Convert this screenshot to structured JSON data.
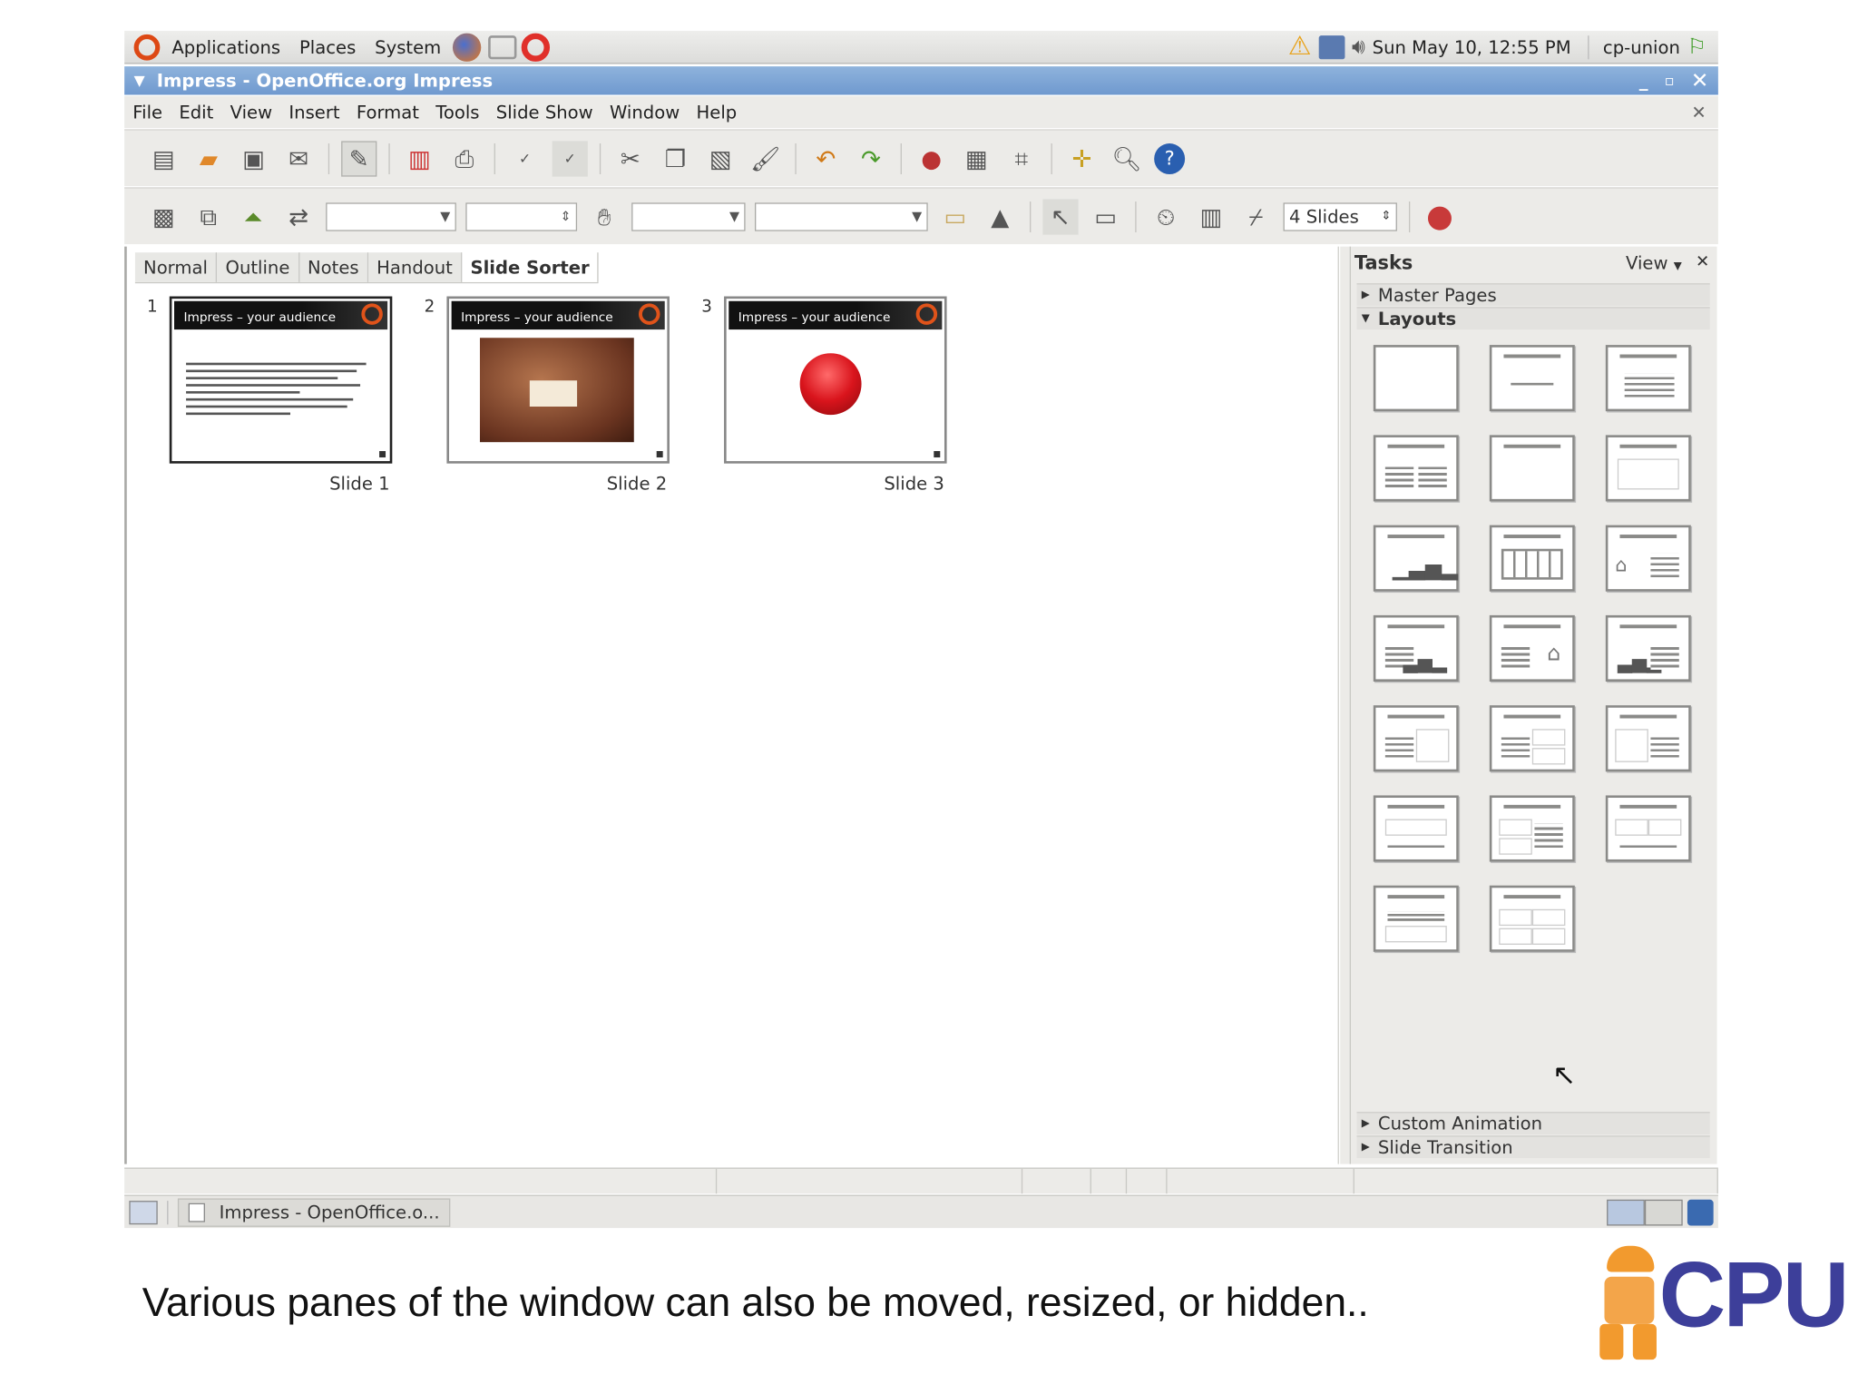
{
  "panel": {
    "applications": "Applications",
    "places": "Places",
    "system": "System",
    "clock": "Sun May 10, 12:55 PM",
    "user": "cp-union"
  },
  "window": {
    "title": "Impress - OpenOffice.org Impress"
  },
  "menus": [
    "File",
    "Edit",
    "View",
    "Insert",
    "Format",
    "Tools",
    "Slide Show",
    "Window",
    "Help"
  ],
  "slides_per_row": "4 Slides",
  "view_tabs": [
    "Normal",
    "Outline",
    "Notes",
    "Handout",
    "Slide Sorter"
  ],
  "slides": [
    {
      "number": "1",
      "label": "Slide 1",
      "header": "Impress – your audience"
    },
    {
      "number": "2",
      "label": "Slide 2",
      "header": "Impress – your audience"
    },
    {
      "number": "3",
      "label": "Slide 3",
      "header": "Impress – your audience"
    }
  ],
  "tasks": {
    "title": "Tasks",
    "view": "View",
    "master_pages": "Master Pages",
    "layouts": "Layouts",
    "custom_animation": "Custom Animation",
    "slide_transition": "Slide Transition"
  },
  "taskbar": {
    "item": "Impress - OpenOffice.o..."
  },
  "caption": "Various panes of the window can also be moved, resized, or hidden..",
  "brand": "CPU",
  "colors": {
    "title_bar": "#7aa3d6",
    "accent_red": "#d9141c",
    "brand_blue": "#3d3f9a",
    "brand_orange": "#f29a2e"
  }
}
